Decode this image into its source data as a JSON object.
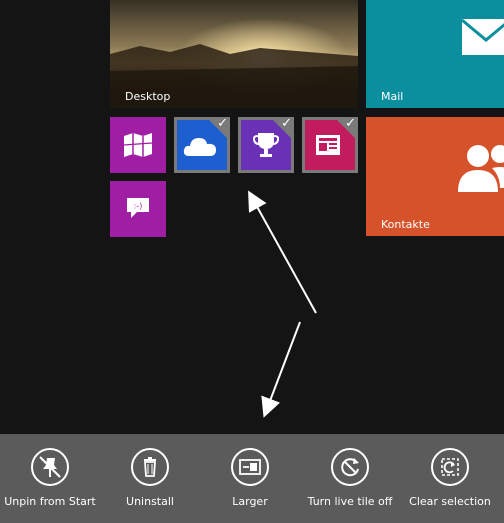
{
  "tiles": {
    "desktop": {
      "label": "Desktop",
      "icon": "desktop-landscape"
    },
    "mail": {
      "label": "Mail",
      "icon": "envelope-icon"
    },
    "contacts": {
      "label": "Kontakte",
      "icon": "people-icon"
    },
    "maps": {
      "icon": "map-icon"
    },
    "skydrive": {
      "icon": "cloud-icon",
      "selected": true
    },
    "games": {
      "icon": "trophy-icon",
      "selected": true
    },
    "news": {
      "icon": "newspaper-icon",
      "selected": true
    },
    "messaging": {
      "icon": "chat-smiley-icon"
    }
  },
  "app_bar": {
    "buttons": [
      {
        "label": "Unpin from Start",
        "icon": "unpin-icon"
      },
      {
        "label": "Uninstall",
        "icon": "trash-icon"
      },
      {
        "label": "Larger",
        "icon": "resize-larger-icon"
      },
      {
        "label": "Turn live tile off",
        "icon": "refresh-icon"
      },
      {
        "label": "Clear selection",
        "icon": "clear-selection-icon"
      }
    ]
  },
  "colors": {
    "background": "#141414",
    "app_bar": "#5b5b5b",
    "mail": "#0b8f9f",
    "contacts": "#d6522a",
    "maps": "#a01ea3",
    "skydrive": "#1e5fd0",
    "games": "#6a30b5",
    "news": "#c21b5e",
    "selection_border": "#7a7a7a"
  }
}
